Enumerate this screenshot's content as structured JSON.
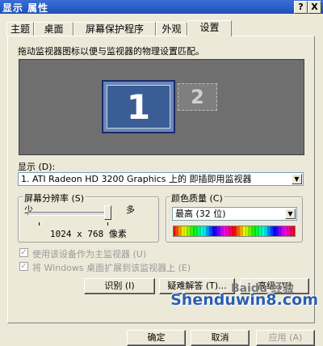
{
  "window": {
    "title": "显示 属性",
    "help": "?",
    "close": "X"
  },
  "tabs": [
    {
      "label": "主题"
    },
    {
      "label": "桌面"
    },
    {
      "label": "屏幕保护程序"
    },
    {
      "label": "外观"
    },
    {
      "label": "设置"
    }
  ],
  "description": "拖动监视器图标以便与监视器的物理设置匹配。",
  "monitors": {
    "primary": "1",
    "secondary": "2"
  },
  "display": {
    "label": "显示 (D):",
    "value": "1. ATI Radeon HD 3200 Graphics 上的 即插即用监视器"
  },
  "resolution": {
    "group_label": "屏幕分辨率 (S)",
    "less": "少",
    "more": "多",
    "value": "1024 x 768 像素",
    "slider_level": 1.0
  },
  "color_quality": {
    "group_label": "颜色质量 (C)",
    "value": "最高 (32 位)"
  },
  "checkboxes": {
    "primary": "使用该设备作为主监视器 (U)",
    "extend": "将 Windows 桌面扩展到该监视器上 (E)"
  },
  "buttons": {
    "identify": "识别 (I)",
    "troubleshoot": "疑难解答 (T)...",
    "advanced": "高级 (V)",
    "ok": "确定",
    "cancel": "取消",
    "apply": "应用 (A)"
  },
  "watermark": {
    "main": "Shenduwin8.com",
    "logo": "Baidu 经验"
  },
  "colors": {
    "titlebar": "#1f4fb8",
    "desktop_preview": "#6f6f6f",
    "primary_monitor": "#3b5d96"
  }
}
